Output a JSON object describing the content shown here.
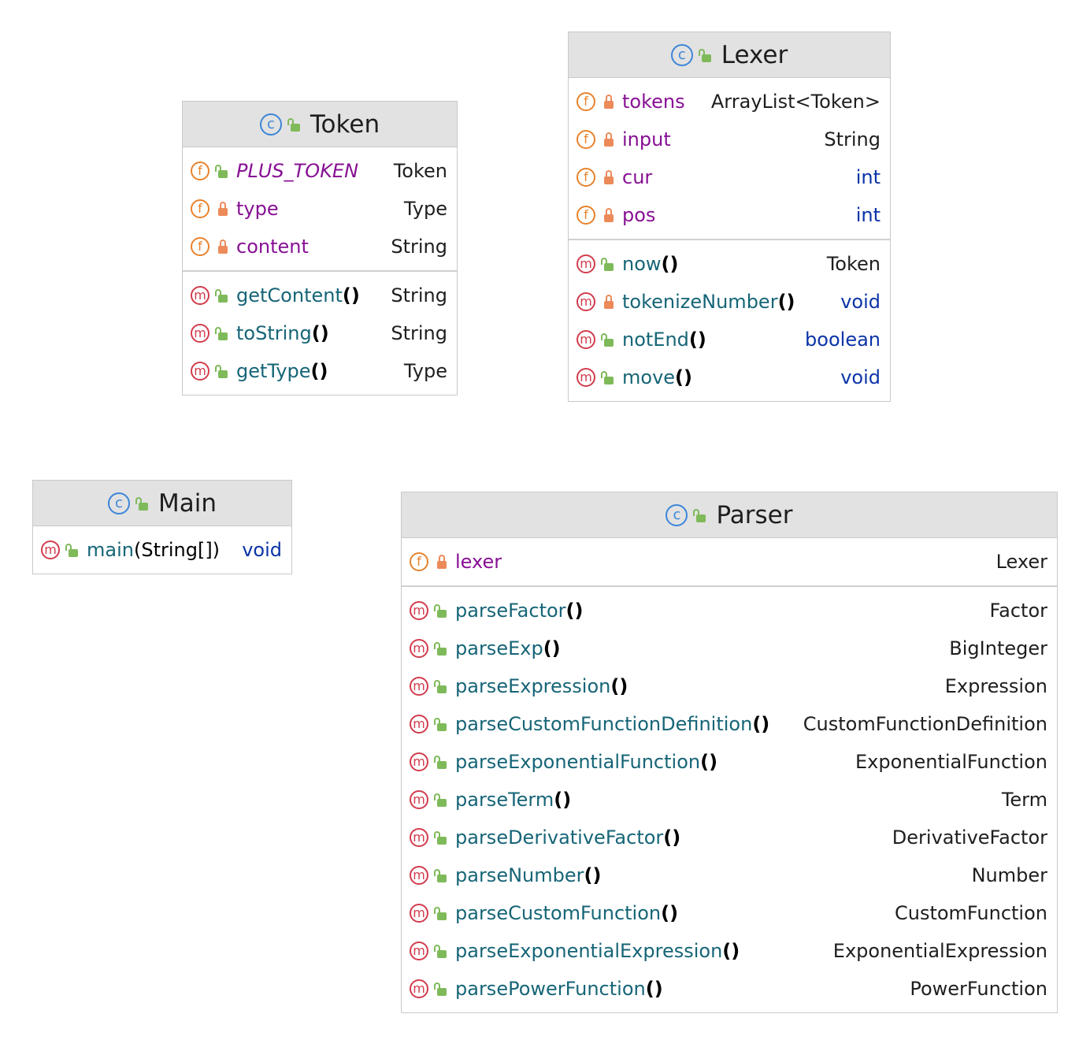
{
  "classes": {
    "token": {
      "title": "Token",
      "fields": [
        {
          "name": "PLUS_TOKEN",
          "type": "Token"
        },
        {
          "name": "type",
          "type": "Type"
        },
        {
          "name": "content",
          "type": "String"
        }
      ],
      "methods": [
        {
          "name": "getContent",
          "parens": "()",
          "type": "String"
        },
        {
          "name": "toString",
          "parens": "()",
          "type": "String"
        },
        {
          "name": "getType",
          "parens": "()",
          "type": "Type"
        }
      ]
    },
    "lexer": {
      "title": "Lexer",
      "fields": [
        {
          "name": "tokens",
          "type": "ArrayList<Token>"
        },
        {
          "name": "input",
          "type": "String"
        },
        {
          "name": "cur",
          "type": "int"
        },
        {
          "name": "pos",
          "type": "int"
        }
      ],
      "methods": [
        {
          "name": "now",
          "parens": "()",
          "type": "Token"
        },
        {
          "name": "tokenizeNumber",
          "parens": "()",
          "type": "void"
        },
        {
          "name": "notEnd",
          "parens": "()",
          "type": "boolean"
        },
        {
          "name": "move",
          "parens": "()",
          "type": "void"
        }
      ]
    },
    "main": {
      "title": "Main",
      "methods": [
        {
          "name": "main",
          "args": "(String[])",
          "type": "void"
        }
      ]
    },
    "parser": {
      "title": "Parser",
      "fields": [
        {
          "name": "lexer",
          "type": "Lexer"
        }
      ],
      "methods": [
        {
          "name": "parseFactor",
          "parens": "()",
          "type": "Factor"
        },
        {
          "name": "parseExp",
          "parens": "()",
          "type": "BigInteger"
        },
        {
          "name": "parseExpression",
          "parens": "()",
          "type": "Expression"
        },
        {
          "name": "parseCustomFunctionDefinition",
          "parens": "()",
          "type": "CustomFunctionDefinition"
        },
        {
          "name": "parseExponentialFunction",
          "parens": "()",
          "type": "ExponentialFunction"
        },
        {
          "name": "parseTerm",
          "parens": "()",
          "type": "Term"
        },
        {
          "name": "parseDerivativeFactor",
          "parens": "()",
          "type": "DerivativeFactor"
        },
        {
          "name": "parseNumber",
          "parens": "()",
          "type": "Number"
        },
        {
          "name": "parseCustomFunction",
          "parens": "()",
          "type": "CustomFunction"
        },
        {
          "name": "parseExponentialExpression",
          "parens": "()",
          "type": "ExponentialExpression"
        },
        {
          "name": "parsePowerFunction",
          "parens": "()",
          "type": "PowerFunction"
        }
      ]
    }
  },
  "icons": {
    "class_badge": "c",
    "field_badge": "f",
    "method_badge": "m"
  },
  "colors": {
    "header_bg": "#e2e2e2",
    "field_name": "#871094",
    "method_name": "#166577",
    "primitive_type": "#0b34a8",
    "class_icon": "#3d86d8",
    "field_icon": "#e8822c",
    "method_icon": "#d23c4d",
    "public_lock": "#7fba5a",
    "private_lock": "#ec8a5a"
  }
}
